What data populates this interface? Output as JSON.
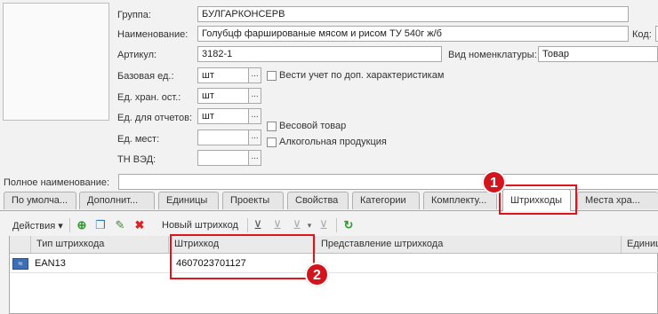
{
  "form": {
    "group_label": "Группа:",
    "group_value": "БУЛГАРКОНСЕРВ",
    "name_label": "Наименование:",
    "name_value": "Голубцф фаршированые мясом и рисом ТУ 540г ж/б",
    "code_label": "Код:",
    "article_label": "Артикул:",
    "article_value": "3182-1",
    "kind_label": "Вид номенклатуры:",
    "kind_value": "Товар",
    "base_unit_label": "Базовая ед.:",
    "base_unit_value": "шт",
    "storage_unit_label": "Ед. хран. ост.:",
    "storage_unit_value": "шт",
    "report_unit_label": "Ед. для отчетов:",
    "report_unit_value": "шт",
    "places_unit_label": "Ед. мест:",
    "places_unit_value": "",
    "tnved_label": "ТН ВЭД:",
    "tnved_value": "",
    "chk_additional": "Вести учет по доп. характеристикам",
    "chk_weight": "Весовой товар",
    "chk_alcohol": "Алкогольная продукция",
    "full_name_label": "Полное наименование:",
    "full_name_value": "",
    "combo_button": "..."
  },
  "tabs": [
    "По умолча...",
    "Дополнит...",
    "Единицы",
    "Проекты",
    "Свойства",
    "Категории",
    "Комплекту...",
    "Штрихкоды",
    "Места хра..."
  ],
  "active_tab": "Штрихкоды",
  "toolbar": {
    "actions_label": "Действия",
    "new_barcode_label": "Новый штрихкод"
  },
  "grid": {
    "columns": [
      "Тип штрихкода",
      "Штрихкод",
      "Представление штрихкода",
      "Единица"
    ],
    "rows": [
      {
        "type": "EAN13",
        "barcode": "4607023701127",
        "representation": "",
        "unit": ""
      }
    ]
  },
  "annotations": {
    "badge1": "1",
    "badge2": "2"
  },
  "colors": {
    "highlight": "#e0141c",
    "badge": "#d4141c"
  }
}
